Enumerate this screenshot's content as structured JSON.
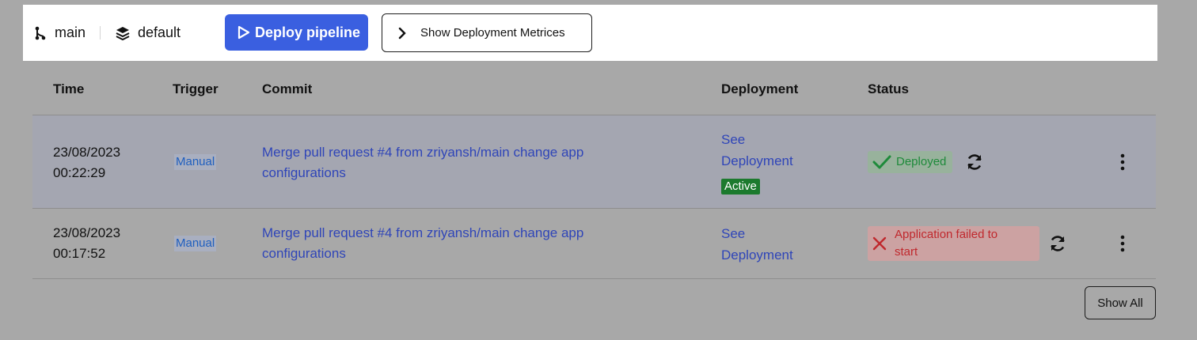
{
  "toolbar": {
    "branch": "main",
    "environment": "default",
    "deploy_label": "Deploy pipeline",
    "metrics_label": "Show Deployment Metrices"
  },
  "table": {
    "columns": [
      "Time",
      "Trigger",
      "Commit",
      "Deployment",
      "Status"
    ],
    "rows": [
      {
        "date": "23/08/2023",
        "time": "00:22:29",
        "trigger": "Manual",
        "commit_line1": "Merge pull request #4 from zriyansh/main change app",
        "commit_line2": "configurations",
        "deployment_line1": "See",
        "deployment_line2": "Deployment",
        "deployment_badge": "Active",
        "status": "Deployed",
        "status_kind": "success"
      },
      {
        "date": "23/08/2023",
        "time": "00:17:52",
        "trigger": "Manual",
        "commit_line1": "Merge pull request #4 from zriyansh/main change app",
        "commit_line2": "configurations",
        "deployment_line1": "See",
        "deployment_line2": "Deployment",
        "status_line1": "Application failed to",
        "status_line2": "start",
        "status_kind": "failed"
      }
    ]
  },
  "show_all_label": "Show All",
  "colors": {
    "primary": "#3a5fe0",
    "success": "#1e8a3a",
    "danger": "#c0282d",
    "link": "#2f45b8",
    "overlay": "#a8a8a8"
  },
  "icons": [
    "git-branch-icon",
    "layers-icon",
    "play-icon",
    "chevron-right-icon",
    "checkmark-icon",
    "x-icon",
    "refresh-icon",
    "more-vertical-icon"
  ]
}
